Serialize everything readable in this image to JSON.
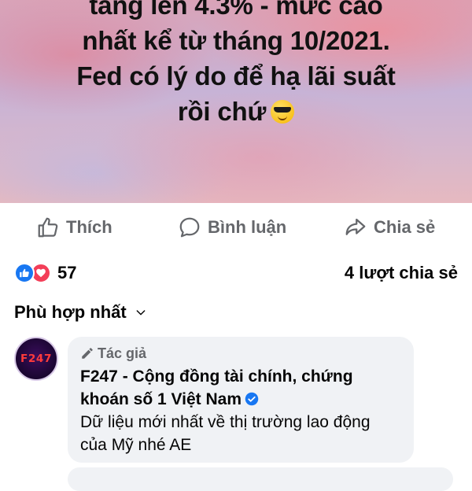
{
  "post": {
    "caption_lines": [
      "tăng lên 4.3% - mức cao",
      "nhất kể từ tháng 10/2021.",
      "Fed có lý do để hạ lãi suất",
      "rồi chứ"
    ],
    "caption_emoji": "sunglasses-emoji"
  },
  "actions": {
    "like_label": "Thích",
    "comment_label": "Bình luận",
    "share_label": "Chia sẻ"
  },
  "stats": {
    "reaction_count": "57",
    "reactions": [
      "like",
      "love"
    ],
    "share_count_text": "4 lượt chia sẻ"
  },
  "comments_sort": {
    "label": "Phù hợp nhất"
  },
  "top_comment": {
    "author_badge": "Tác giả",
    "author_name": "F247 - Cộng đồng tài chính, chứng khoán số 1 Việt Nam",
    "verified": true,
    "text": "Dữ liệu mới nhất về thị trường lao động của Mỹ nhé AE",
    "avatar_logo": "F247"
  },
  "colors": {
    "like_blue": "#1877f2",
    "love_red": "#f33e58",
    "secondary_text": "#65676b",
    "bubble_bg": "#f0f2f5"
  }
}
